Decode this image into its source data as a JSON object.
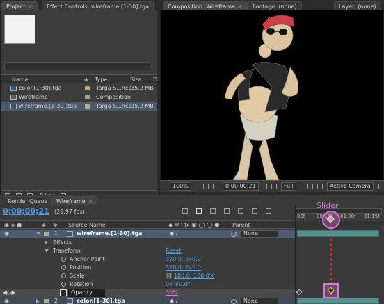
{
  "top_tabs": {
    "project": "Project",
    "effect_controls": "Effect Controls: wireframe.[1-30].tga",
    "composition": "Composition: Wireframe",
    "footage": "Footage: (none)",
    "layer": "Layer: (none)"
  },
  "project": {
    "columns": {
      "name": "Name",
      "type": "Type",
      "size": "Size",
      "d": "D"
    },
    "items": [
      {
        "name": "color.[1-30].tga",
        "type": "Targa S...nce",
        "size": "35.2 MB",
        "kind": "footage"
      },
      {
        "name": "Wireframe",
        "type": "Composition",
        "size": "",
        "kind": "comp"
      },
      {
        "name": "wireframe.[1-30].tga",
        "type": "Targa S...nce",
        "size": "35.2 MB",
        "kind": "footage"
      }
    ],
    "bpc": "8 bpc"
  },
  "comp_bar": {
    "zoom": "100%",
    "timecode": "0;00;00;21",
    "resolution": "Full",
    "camera": "Active Camera"
  },
  "timeline": {
    "tabs": {
      "render_queue": "Render Queue",
      "wireframe": "Wireframe"
    },
    "timecode": "0;00;00;21",
    "fps": "(29.97 fps)",
    "columns": {
      "hash": "#",
      "source_name": "Source Name",
      "parent": "Parent"
    },
    "ruler": [
      "00f",
      "00:15f",
      "01:00f",
      "01:15f"
    ],
    "layers": [
      {
        "num": "1",
        "name": "wireframe.[1-30].tga",
        "parent": "None"
      },
      {
        "num": "2",
        "name": "color.[1-30].tga",
        "parent": "None"
      }
    ],
    "effects_label": "Effects",
    "transform_label": "Transform",
    "reset_label": "Reset",
    "props": [
      {
        "label": "Anchor Point",
        "value": "320.0, 240.0"
      },
      {
        "label": "Position",
        "value": "320.0, 240.0"
      },
      {
        "label": "Scale",
        "value": "100.0, 100.0%"
      },
      {
        "label": "Rotation",
        "value": "0x +0.0°"
      },
      {
        "label": "Opacity",
        "value": "30%"
      }
    ]
  },
  "annotation": {
    "slider_label": "Slider",
    "color": "#e070e0"
  },
  "colors": {
    "accent": "#5aa0e6",
    "timecode": "#4c9be8"
  }
}
